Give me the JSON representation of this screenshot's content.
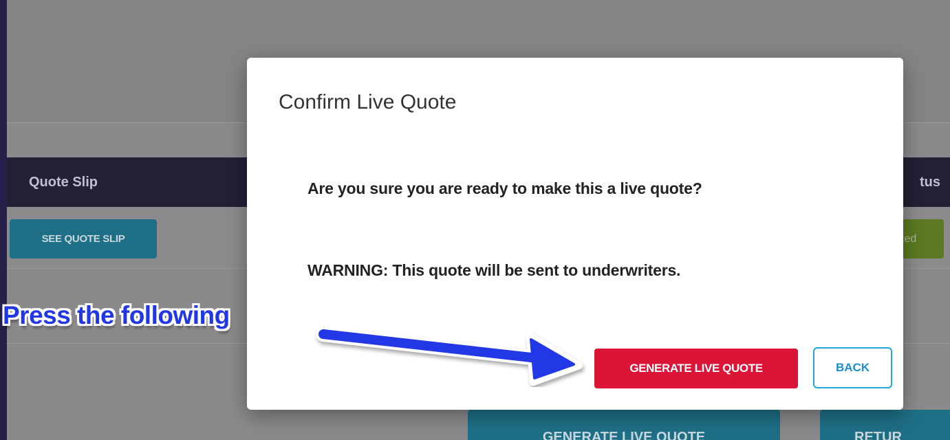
{
  "background": {
    "table_headers": [
      "Quote Slip",
      "Status"
    ],
    "status_header_visible": "tus",
    "see_quote_slip_label": "SEE QUOTE SLIP",
    "status_badge_visible": "ted",
    "bottom_generate_label": "GENERATE LIVE QUOTE",
    "bottom_return_label": "RETUR"
  },
  "modal": {
    "title": "Confirm Live Quote",
    "question": "Are you sure you are ready to make this a live quote?",
    "warning": "WARNING: This quote will be sent to underwriters.",
    "generate_label": "GENERATE LIVE QUOTE",
    "back_label": "BACK"
  },
  "annotation": {
    "text": "Press the following"
  },
  "colors": {
    "overlay_bg": "#8a8a8c",
    "header_bg": "#232036",
    "generate_button": "#dc1438",
    "back_border": "#1fa7e0",
    "callout_text": "#2137e6",
    "frame": "#26204a"
  }
}
